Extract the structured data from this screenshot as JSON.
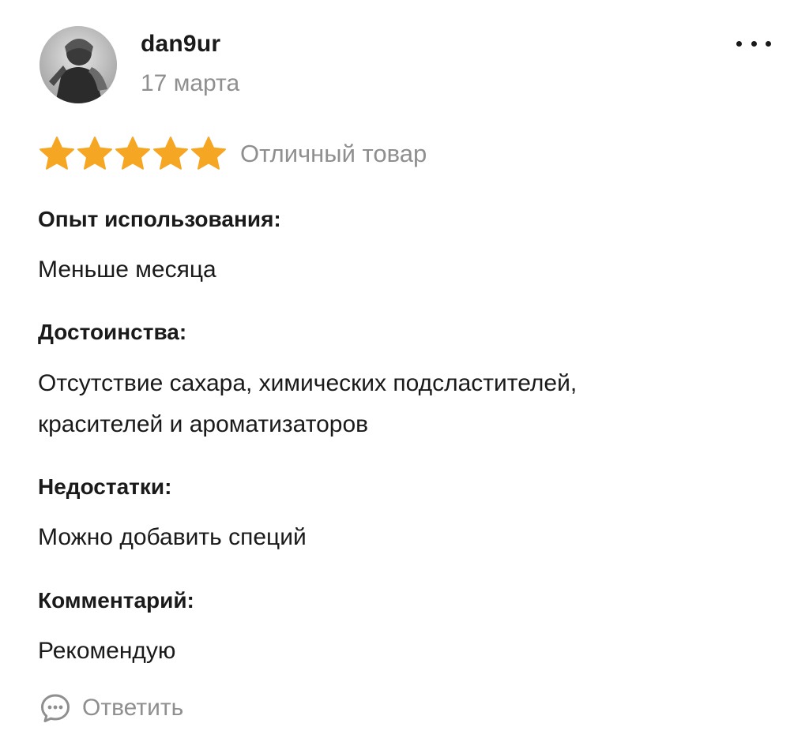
{
  "review": {
    "author": {
      "name": "dan9ur",
      "date": "17 марта",
      "avatar_icon": "user-avatar-photo"
    },
    "menu_icon": "more-dots-icon",
    "rating": {
      "stars": 5,
      "max_stars": 5,
      "star_color": "#f5a623",
      "label": "Отличный товар"
    },
    "sections": [
      {
        "title": "Опыт использования:",
        "text": "Меньше месяца"
      },
      {
        "title": "Достоинства:",
        "text": "Отсутствие сахара, химических подсластителей, красителей и ароматизаторов"
      },
      {
        "title": "Недостатки:",
        "text": "Можно добавить специй"
      },
      {
        "title": "Комментарий:",
        "text": "Рекомендую"
      }
    ],
    "reply": {
      "label": "Ответить",
      "icon": "comment-bubble-icon"
    }
  }
}
